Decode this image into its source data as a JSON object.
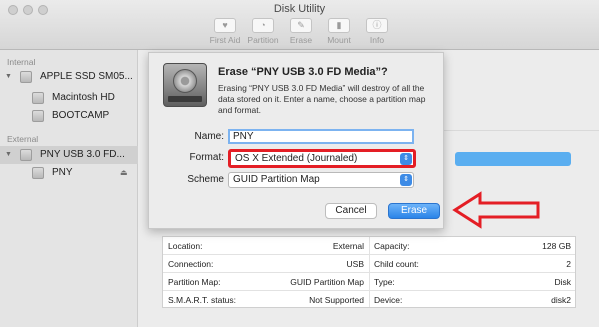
{
  "window": {
    "title": "Disk Utility"
  },
  "toolbar": [
    {
      "label": "First Aid",
      "glyph": "♥"
    },
    {
      "label": "Partition",
      "glyph": "◔"
    },
    {
      "label": "Erase",
      "glyph": "✎"
    },
    {
      "label": "Mount",
      "glyph": "▮"
    },
    {
      "label": "Info",
      "glyph": "ⓘ"
    }
  ],
  "sidebar": {
    "internal_header": "Internal",
    "external_header": "External",
    "items": [
      {
        "label": "APPLE SSD SM05..."
      },
      {
        "label": "Macintosh HD"
      },
      {
        "label": "BOOTCAMP"
      },
      {
        "label": "PNY USB 3.0 FD..."
      },
      {
        "label": "PNY"
      }
    ],
    "eject_glyph": "⏏"
  },
  "sheet": {
    "title": "Erase “PNY USB 3.0 FD Media”?",
    "description": "Erasing “PNY USB 3.0 FD Media” will destroy of all the data stored on it. Enter a name, choose a partition map and format.",
    "name_label": "Name:",
    "name_value": "PNY",
    "format_label": "Format:",
    "format_value": "OS X Extended (Journaled)",
    "scheme_label": "Scheme",
    "scheme_value": "GUID Partition Map",
    "select_arrow": "⇕",
    "cancel_label": "Cancel",
    "erase_label": "Erase"
  },
  "info": {
    "rows": [
      {
        "k1": "Location:",
        "v1": "External",
        "k2": "Capacity:",
        "v2": "128 GB"
      },
      {
        "k1": "Connection:",
        "v1": "USB",
        "k2": "Child count:",
        "v2": "2"
      },
      {
        "k1": "Partition Map:",
        "v1": "GUID Partition Map",
        "k2": "Type:",
        "v2": "Disk"
      },
      {
        "k1": "S.M.A.R.T. status:",
        "v1": "Not Supported",
        "k2": "Device:",
        "v2": "disk2"
      }
    ]
  },
  "colors": {
    "highlight": "#e41e25",
    "accent": "#2a84e8"
  }
}
